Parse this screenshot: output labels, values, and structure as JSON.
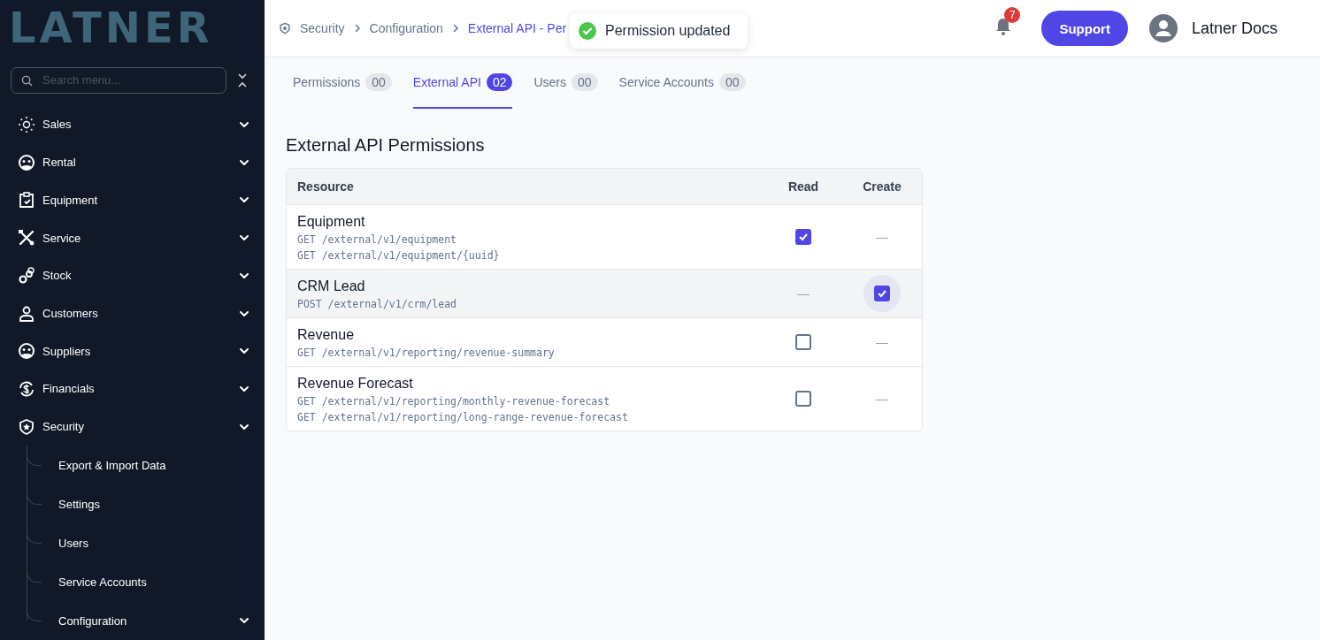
{
  "logo": {
    "text": "LATNER"
  },
  "sidebar": {
    "search": {
      "placeholder": "Search menu..."
    },
    "items": [
      {
        "label": "Sales"
      },
      {
        "label": "Rental"
      },
      {
        "label": "Equipment"
      },
      {
        "label": "Service"
      },
      {
        "label": "Stock"
      },
      {
        "label": "Customers"
      },
      {
        "label": "Suppliers"
      },
      {
        "label": "Financials"
      },
      {
        "label": "Security",
        "children": [
          {
            "label": "Export & Import Data"
          },
          {
            "label": "Settings"
          },
          {
            "label": "Users"
          },
          {
            "label": "Service Accounts"
          },
          {
            "label": "Configuration",
            "has_children": true
          }
        ]
      }
    ]
  },
  "breadcrumb": [
    {
      "label": "Security",
      "current": false
    },
    {
      "label": "Configuration",
      "current": false
    },
    {
      "label": "External API - Per",
      "current": true
    }
  ],
  "toast": {
    "message": "Permission updated"
  },
  "header": {
    "notifications": "7",
    "support_button": "Support",
    "user_name": "Latner Docs"
  },
  "tabs": [
    {
      "label": "Permissions",
      "count": "00",
      "selected": false
    },
    {
      "label": "External API",
      "count": "02",
      "selected": true
    },
    {
      "label": "Users",
      "count": "00",
      "selected": false
    },
    {
      "label": "Service Accounts",
      "count": "00",
      "selected": false
    }
  ],
  "section_title": "External API Permissions",
  "table": {
    "columns": [
      "Resource",
      "Read",
      "Create"
    ],
    "rows": [
      {
        "highlighted": false,
        "cells": [
          {
            "kind": "resource",
            "name": "Equipment",
            "endpoints": [
              "GET /external/v1/equipment",
              "GET /external/v1/equipment/{uuid}"
            ]
          },
          {
            "kind": "checkbox",
            "checked": true,
            "focused": false
          },
          {
            "kind": "none",
            "text": "—"
          }
        ]
      },
      {
        "highlighted": true,
        "cells": [
          {
            "kind": "resource",
            "name": "CRM Lead",
            "endpoints": [
              "POST /external/v1/crm/lead"
            ]
          },
          {
            "kind": "none",
            "text": "—"
          },
          {
            "kind": "checkbox",
            "checked": true,
            "focused": true
          }
        ]
      },
      {
        "highlighted": false,
        "cells": [
          {
            "kind": "resource",
            "name": "Revenue",
            "endpoints": [
              "GET /external/v1/reporting/revenue-summary"
            ]
          },
          {
            "kind": "checkbox",
            "checked": false,
            "focused": false
          },
          {
            "kind": "none",
            "text": "—"
          }
        ]
      },
      {
        "highlighted": false,
        "cells": [
          {
            "kind": "resource",
            "name": "Revenue Forecast",
            "endpoints": [
              "GET /external/v1/reporting/monthly-revenue-forecast",
              "GET /external/v1/reporting/long-range-revenue-forecast"
            ]
          },
          {
            "kind": "checkbox",
            "checked": false,
            "focused": false
          },
          {
            "kind": "none",
            "text": "—"
          }
        ]
      }
    ]
  }
}
